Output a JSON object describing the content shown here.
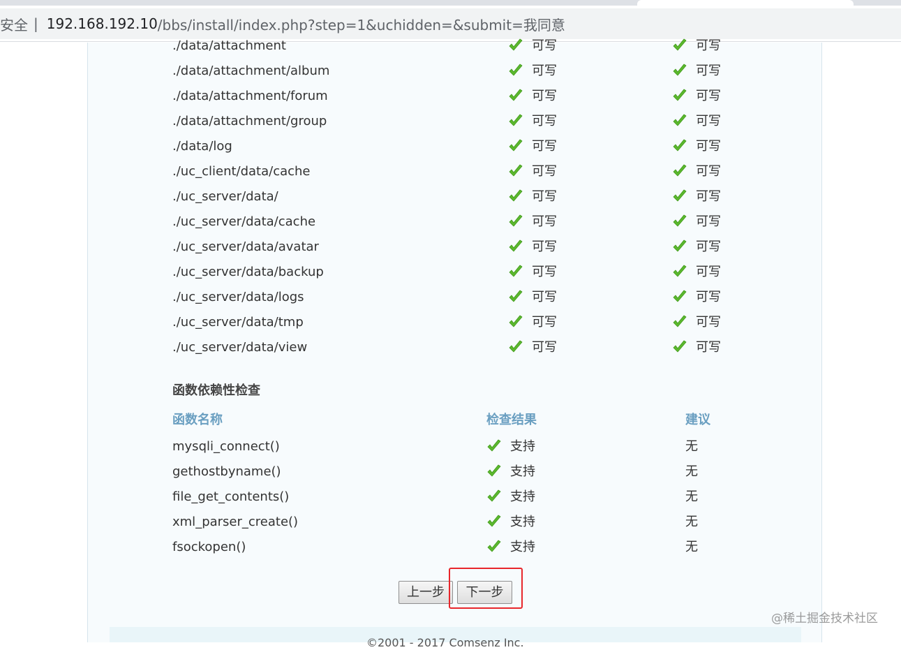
{
  "browser": {
    "security_label": "安全",
    "separator": "|",
    "url_host": "192.168.192.10",
    "url_path": "/bbs/install/index.php?step=1&uchidden=&submit=我同意"
  },
  "directory_check": {
    "rows": [
      {
        "path": "./data/attachment",
        "current": "可写",
        "required": "可写"
      },
      {
        "path": "./data/attachment/album",
        "current": "可写",
        "required": "可写"
      },
      {
        "path": "./data/attachment/forum",
        "current": "可写",
        "required": "可写"
      },
      {
        "path": "./data/attachment/group",
        "current": "可写",
        "required": "可写"
      },
      {
        "path": "./data/log",
        "current": "可写",
        "required": "可写"
      },
      {
        "path": "./uc_client/data/cache",
        "current": "可写",
        "required": "可写"
      },
      {
        "path": "./uc_server/data/",
        "current": "可写",
        "required": "可写"
      },
      {
        "path": "./uc_server/data/cache",
        "current": "可写",
        "required": "可写"
      },
      {
        "path": "./uc_server/data/avatar",
        "current": "可写",
        "required": "可写"
      },
      {
        "path": "./uc_server/data/backup",
        "current": "可写",
        "required": "可写"
      },
      {
        "path": "./uc_server/data/logs",
        "current": "可写",
        "required": "可写"
      },
      {
        "path": "./uc_server/data/tmp",
        "current": "可写",
        "required": "可写"
      },
      {
        "path": "./uc_server/data/view",
        "current": "可写",
        "required": "可写"
      }
    ]
  },
  "function_check": {
    "title": "函数依赖性检查",
    "headers": {
      "name": "函数名称",
      "result": "检查结果",
      "advice": "建议"
    },
    "rows": [
      {
        "name": "mysqli_connect()",
        "result": "支持",
        "advice": "无"
      },
      {
        "name": "gethostbyname()",
        "result": "支持",
        "advice": "无"
      },
      {
        "name": "file_get_contents()",
        "result": "支持",
        "advice": "无"
      },
      {
        "name": "xml_parser_create()",
        "result": "支持",
        "advice": "无"
      },
      {
        "name": "fsockopen()",
        "result": "支持",
        "advice": "无"
      }
    ]
  },
  "buttons": {
    "prev_label": "上一步",
    "next_label": "下一步"
  },
  "footer": {
    "text": "©2001 - 2017 Comsenz Inc."
  },
  "watermark": "@稀土掘金技术社区",
  "colors": {
    "check": "#5cb82e",
    "header_blue": "#6a9fc1",
    "highlight": "#e8262b",
    "panel_bg": "#f7fbfd"
  }
}
